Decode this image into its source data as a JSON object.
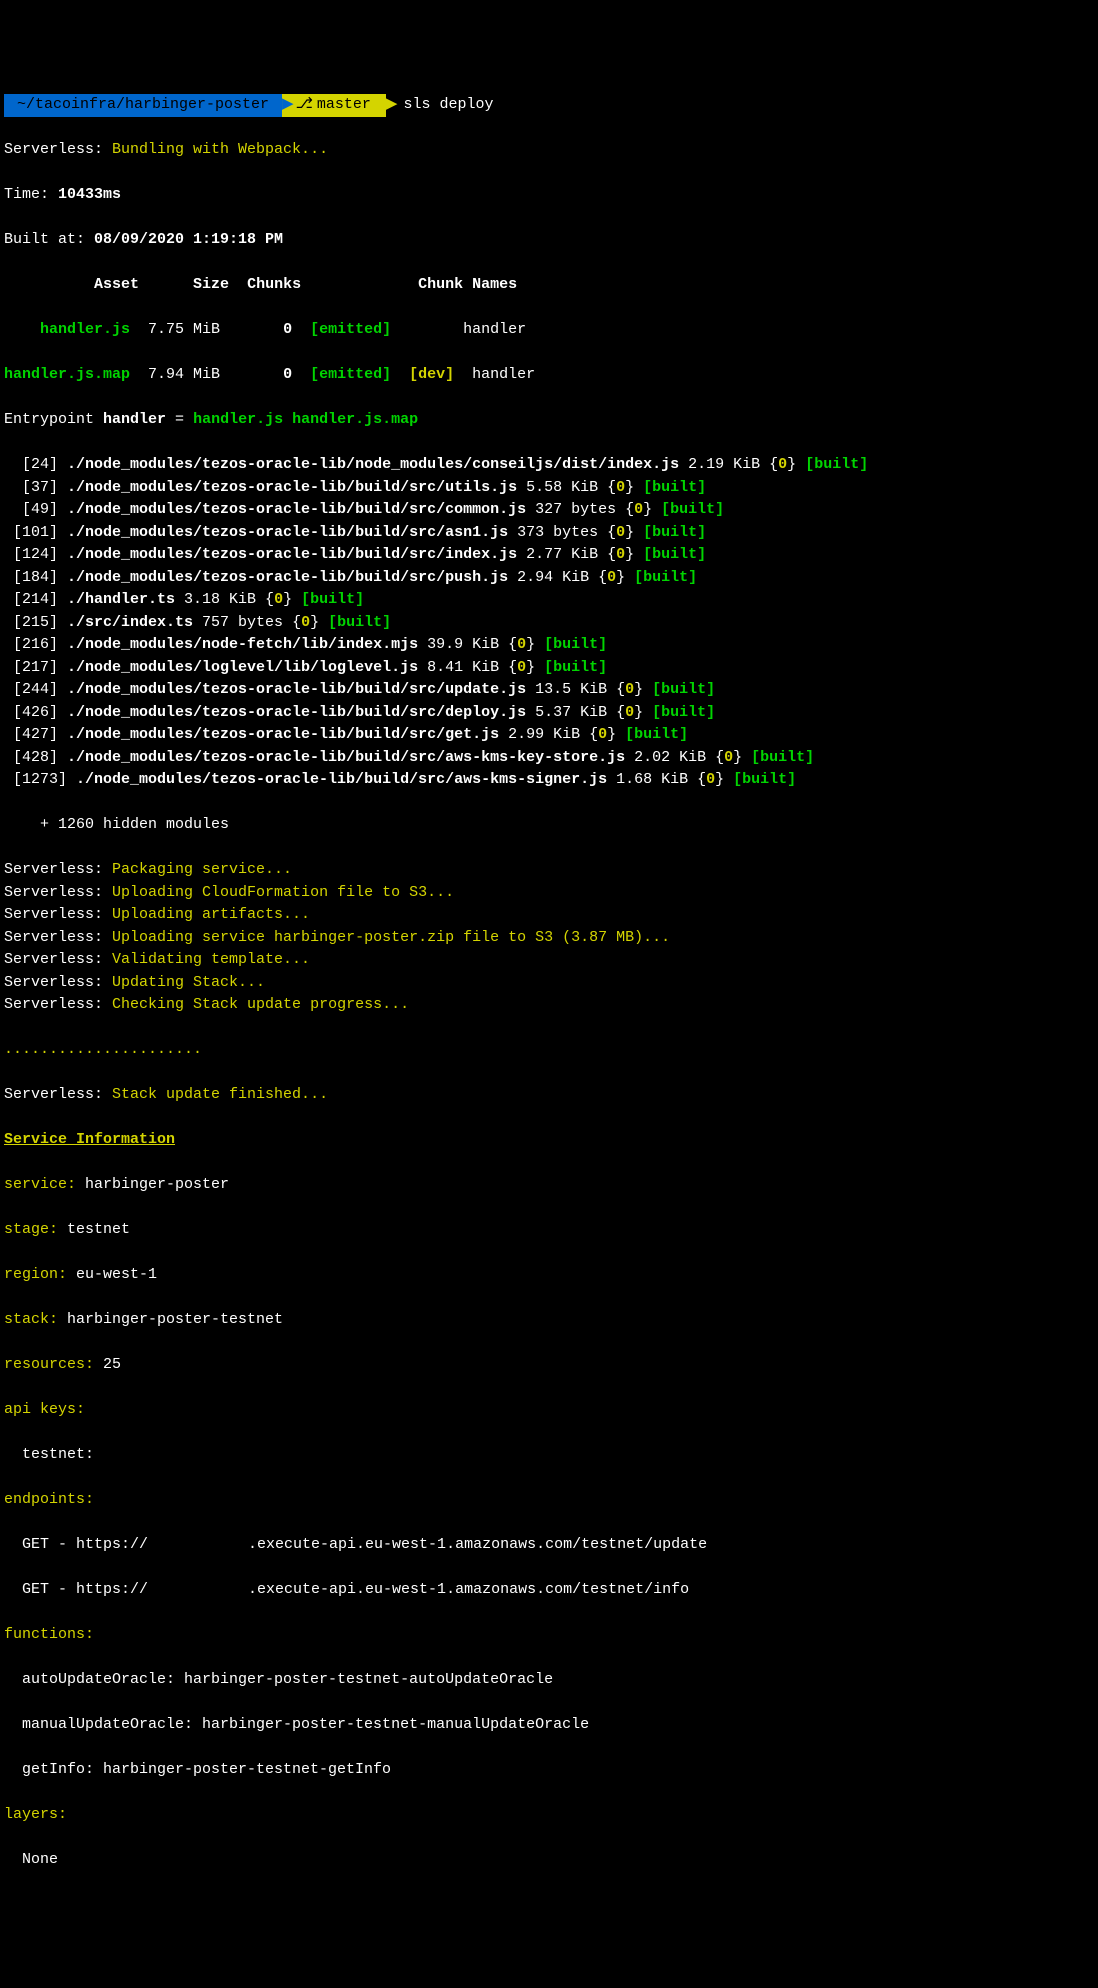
{
  "prompt": {
    "path": " ~/tacoinfra/harbinger-poster ",
    "branch": "master ",
    "command": "sls deploy"
  },
  "bundling": {
    "prefix": "Serverless: ",
    "msg": "Bundling with Webpack..."
  },
  "time": {
    "label": "Time: ",
    "value": "10433ms"
  },
  "built": {
    "label": "Built at: ",
    "value": "08/09/2020 1:19:18 PM"
  },
  "table": {
    "header": {
      "asset": "Asset",
      "size": "Size",
      "chunks": "Chunks",
      "gap": "",
      "chunkNames": "Chunk Names"
    },
    "row1": {
      "asset": "handler.js",
      "size": "7.75 MiB",
      "chunks": "0",
      "emitted": "[emitted]",
      "dev": "",
      "name": "handler"
    },
    "row2": {
      "asset": "handler.js.map",
      "size": "7.94 MiB",
      "chunks": "0",
      "emitted": "[emitted]",
      "dev": "[dev]",
      "name": "handler"
    }
  },
  "entrypoint": {
    "label": "Entrypoint ",
    "handler": "handler",
    "eq": " = ",
    "f1": "handler.js",
    "f2": " handler.js.map"
  },
  "modules": [
    {
      "id": " [24]",
      "path": "./node_modules/tezos-oracle-lib/node_modules/conseiljs/dist/index.js",
      "size": "2.19 KiB",
      "chunk": "0",
      "built": "[built]"
    },
    {
      "id": " [37]",
      "path": "./node_modules/tezos-oracle-lib/build/src/utils.js",
      "size": "5.58 KiB",
      "chunk": "0",
      "built": "[built]"
    },
    {
      "id": " [49]",
      "path": "./node_modules/tezos-oracle-lib/build/src/common.js",
      "size": "327 bytes",
      "chunk": "0",
      "built": "[built]"
    },
    {
      "id": "[101]",
      "path": "./node_modules/tezos-oracle-lib/build/src/asn1.js",
      "size": "373 bytes",
      "chunk": "0",
      "built": "[built]"
    },
    {
      "id": "[124]",
      "path": "./node_modules/tezos-oracle-lib/build/src/index.js",
      "size": "2.77 KiB",
      "chunk": "0",
      "built": "[built]"
    },
    {
      "id": "[184]",
      "path": "./node_modules/tezos-oracle-lib/build/src/push.js",
      "size": "2.94 KiB",
      "chunk": "0",
      "built": "[built]"
    },
    {
      "id": "[214]",
      "path": "./handler.ts",
      "size": "3.18 KiB",
      "chunk": "0",
      "built": "[built]"
    },
    {
      "id": "[215]",
      "path": "./src/index.ts",
      "size": "757 bytes",
      "chunk": "0",
      "built": "[built]"
    },
    {
      "id": "[216]",
      "path": "./node_modules/node-fetch/lib/index.mjs",
      "size": "39.9 KiB",
      "chunk": "0",
      "built": "[built]"
    },
    {
      "id": "[217]",
      "path": "./node_modules/loglevel/lib/loglevel.js",
      "size": "8.41 KiB",
      "chunk": "0",
      "built": "[built]"
    },
    {
      "id": "[244]",
      "path": "./node_modules/tezos-oracle-lib/build/src/update.js",
      "size": "13.5 KiB",
      "chunk": "0",
      "built": "[built]"
    },
    {
      "id": "[426]",
      "path": "./node_modules/tezos-oracle-lib/build/src/deploy.js",
      "size": "5.37 KiB",
      "chunk": "0",
      "built": "[built]"
    },
    {
      "id": "[427]",
      "path": "./node_modules/tezos-oracle-lib/build/src/get.js",
      "size": "2.99 KiB",
      "chunk": "0",
      "built": "[built]"
    },
    {
      "id": "[428]",
      "path": "./node_modules/tezos-oracle-lib/build/src/aws-kms-key-store.js",
      "size": "2.02 KiB",
      "chunk": "0",
      "built": "[built]"
    },
    {
      "id": "[1273]",
      "path": "./node_modules/tezos-oracle-lib/build/src/aws-kms-signer.js",
      "size": "1.68 KiB",
      "chunk": "0",
      "built": "[built]"
    }
  ],
  "hidden": "    + 1260 hidden modules",
  "serverless": [
    "Packaging service...",
    "Uploading CloudFormation file to S3...",
    "Uploading artifacts...",
    "Uploading service harbinger-poster.zip file to S3 (3.87 MB)...",
    "Validating template...",
    "Updating Stack...",
    "Checking Stack update progress..."
  ],
  "dots": "......................",
  "stackFinished": {
    "prefix": "Serverless: ",
    "msg": "Stack update finished..."
  },
  "serviceInfo": {
    "heading": "Service Information",
    "serviceLabel": "service:",
    "service": " harbinger-poster",
    "stageLabel": "stage:",
    "stage": " testnet",
    "regionLabel": "region:",
    "region": " eu-west-1",
    "stackLabel": "stack:",
    "stack": " harbinger-poster-testnet",
    "resourcesLabel": "resources:",
    "resources": " 25",
    "apiKeysLabel": "api keys:",
    "testnetLabel": "  testnet:",
    "endpointsLabel": "endpoints:",
    "ep1a": "  GET - https://",
    "ep1b": ".execute-api.eu-west-1.amazonaws.com/testnet/update",
    "ep2a": "  GET - https://",
    "ep2b": ".execute-api.eu-west-1.amazonaws.com/testnet/info",
    "functionsLabel": "functions:",
    "fn1": "  autoUpdateOracle: harbinger-poster-testnet-autoUpdateOracle",
    "fn2": "  manualUpdateOracle: harbinger-poster-testnet-manualUpdateOracle",
    "fn3": "  getInfo: harbinger-poster-testnet-getInfo",
    "layersLabel": "layers:",
    "layersNone": "  None"
  },
  "prefix": "Serverless: "
}
